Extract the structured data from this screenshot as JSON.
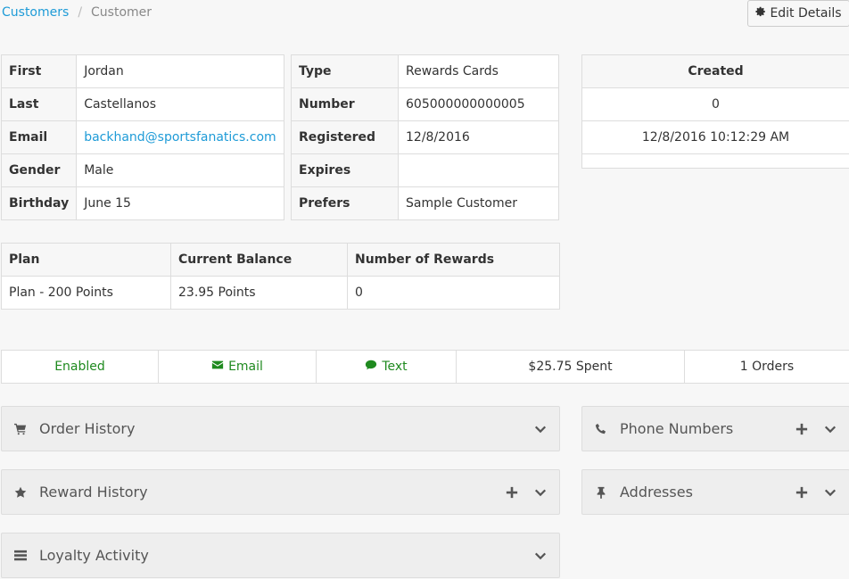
{
  "breadcrumb": {
    "parent": "Customers",
    "current": "Customer",
    "separator": "/"
  },
  "edit_button": {
    "label": "Edit Details",
    "icon": "gear-icon"
  },
  "personal": {
    "first": {
      "label": "First",
      "value": "Jordan"
    },
    "last": {
      "label": "Last",
      "value": "Castellanos"
    },
    "email": {
      "label": "Email",
      "value": "backhand@sportsfanatics.com"
    },
    "gender": {
      "label": "Gender",
      "value": "Male"
    },
    "birthday": {
      "label": "Birthday",
      "value": "June 15"
    }
  },
  "card": {
    "type": {
      "label": "Type",
      "value": "Rewards Cards"
    },
    "number": {
      "label": "Number",
      "value": "605000000000005"
    },
    "registered": {
      "label": "Registered",
      "value": "12/8/2016"
    },
    "expires": {
      "label": "Expires",
      "value": ""
    },
    "prefers": {
      "label": "Prefers",
      "value": "Sample Customer"
    }
  },
  "created": {
    "header": "Created",
    "value": "0",
    "timestamp": "12/8/2016 10:12:29 AM"
  },
  "plan": {
    "headers": [
      "Plan",
      "Current Balance",
      "Number of Rewards"
    ],
    "row": [
      "Plan - 200 Points",
      "23.95 Points",
      "0"
    ]
  },
  "status": {
    "enabled": "Enabled",
    "email": "Email",
    "text": "Text",
    "spent": "$25.75 Spent",
    "orders": "1 Orders",
    "color_green": "#1f8a1f"
  },
  "panels": {
    "order_history": {
      "title": "Order History",
      "icon": "cart-icon"
    },
    "reward_history": {
      "title": "Reward History",
      "icon": "star-icon"
    },
    "loyalty_activity": {
      "title": "Loyalty Activity",
      "icon": "list-icon"
    },
    "phone_numbers": {
      "title": "Phone Numbers",
      "icon": "phone-icon"
    },
    "addresses": {
      "title": "Addresses",
      "icon": "pin-icon"
    }
  }
}
